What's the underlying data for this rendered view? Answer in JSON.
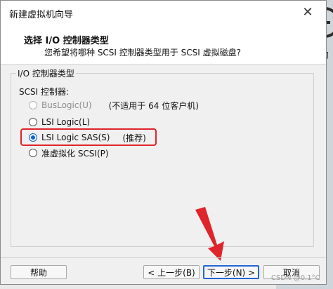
{
  "background": {
    "text": "的"
  },
  "window": {
    "title": "新建虚拟机向导",
    "close_glyph": "✕"
  },
  "header": {
    "title": "选择 I/O 控制器类型",
    "subtitle": "您希望将哪种 SCSI 控制器类型用于 SCSI 虚拟磁盘?"
  },
  "group": {
    "label": "I/O 控制器类型",
    "subheading": "SCSI 控制器:"
  },
  "options": [
    {
      "label": "BusLogic(U)",
      "note": "(不适用于 64 位客户机)",
      "disabled": true,
      "checked": false
    },
    {
      "label": "LSI Logic(L)",
      "disabled": false,
      "checked": false
    },
    {
      "label": "LSI Logic SAS(S)",
      "note": "(推荐)",
      "disabled": false,
      "checked": true
    },
    {
      "label": "准虚拟化 SCSI(P)",
      "disabled": false,
      "checked": false
    }
  ],
  "buttons": {
    "help": "帮助",
    "back": "< 上一步(B)",
    "next": "下一步(N) >",
    "cancel": "取消"
  },
  "watermark": "CSDN @0.1°C",
  "colors": {
    "accent": "#0b62d6",
    "annotation_red": "#e0242b"
  }
}
